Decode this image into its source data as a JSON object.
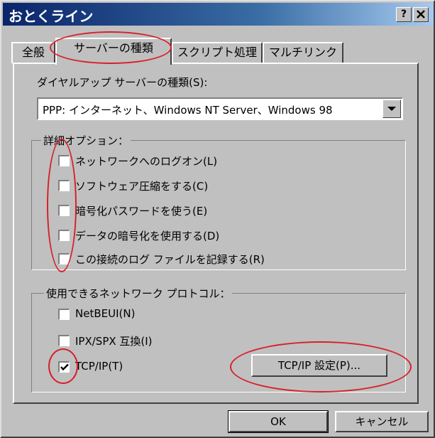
{
  "window": {
    "title": "おとくライン",
    "help_label": "?",
    "close_label": "X"
  },
  "tabs": [
    {
      "label": "全般",
      "active": false
    },
    {
      "label": "サーバーの種類",
      "active": true
    },
    {
      "label": "スクリプト処理",
      "active": false
    },
    {
      "label": "マルチリンク",
      "active": false
    }
  ],
  "server_type": {
    "label": "ダイヤルアップ サーバーの種類(S):",
    "selected": "PPP: インターネット、Windows NT Server、Windows 98"
  },
  "advanced_options": {
    "legend": "詳細オプション：",
    "items": [
      {
        "label": "ネットワークへのログオン(L)",
        "checked": false
      },
      {
        "label": "ソフトウェア圧縮をする(C)",
        "checked": false
      },
      {
        "label": "暗号化パスワードを使う(E)",
        "checked": false
      },
      {
        "label": "データの暗号化を使用する(D)",
        "checked": false
      },
      {
        "label": "この接続のログ ファイルを記録する(R)",
        "checked": false
      }
    ]
  },
  "protocols": {
    "legend": "使用できるネットワーク プロトコル：",
    "items": [
      {
        "label": "NetBEUI(N)",
        "checked": false
      },
      {
        "label": "IPX/SPX 互換(I)",
        "checked": false
      },
      {
        "label": "TCP/IP(T)",
        "checked": true
      }
    ],
    "settings_button": "TCP/IP 設定(P)..."
  },
  "footer": {
    "ok": "OK",
    "cancel": "キャンセル"
  },
  "colors": {
    "dialog_face": "#c0c0c0",
    "title_bar": "#0a246a",
    "annotation": "#d8202a"
  }
}
